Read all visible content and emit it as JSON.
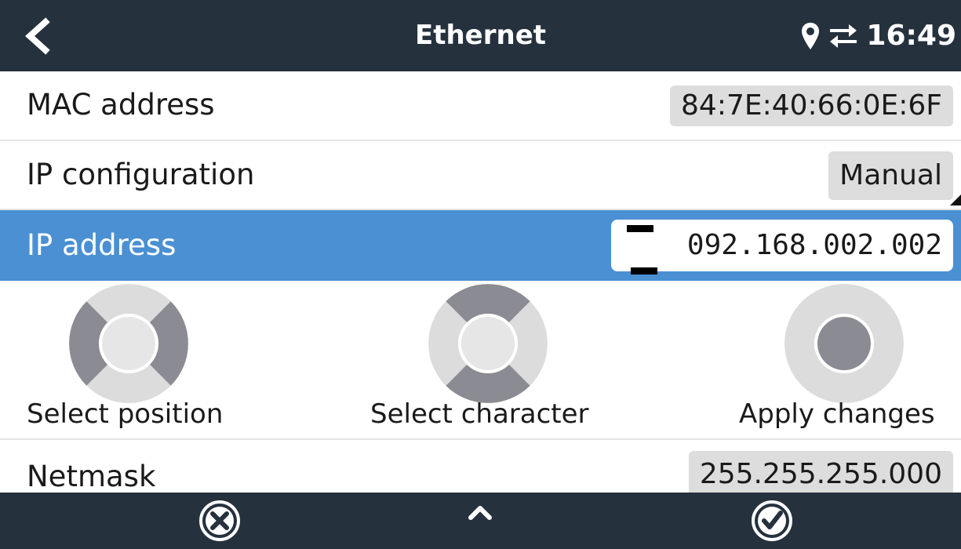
{
  "header": {
    "title": "Ethernet",
    "time": "16:49",
    "back_icon": "chevron-left-icon",
    "location_icon": "location-pin-icon",
    "connection_icon": "swap-arrows-icon"
  },
  "rows": {
    "mac": {
      "label": "MAC address",
      "value": "84:7E:40:66:0E:6F"
    },
    "ip_config": {
      "label": "IP configuration",
      "value": "Manual"
    },
    "ip_address": {
      "label": "IP address",
      "value": "092.168.002.002",
      "cursor_position": 0
    },
    "netmask": {
      "label": "Netmask",
      "value": "255.255.255.000"
    }
  },
  "help": {
    "select_position": "Select position",
    "select_character": "Select character",
    "apply_changes": "Apply changes"
  },
  "footer": {
    "cancel_icon": "cancel-circle-icon",
    "up_icon": "chevron-up-icon",
    "confirm_icon": "check-circle-icon"
  },
  "colors": {
    "bar": "#26313e",
    "highlight": "#4a90d2",
    "value_bg": "#dddddd",
    "dpad_dark": "#8b8b93",
    "dpad_light": "#dcdcdc"
  }
}
